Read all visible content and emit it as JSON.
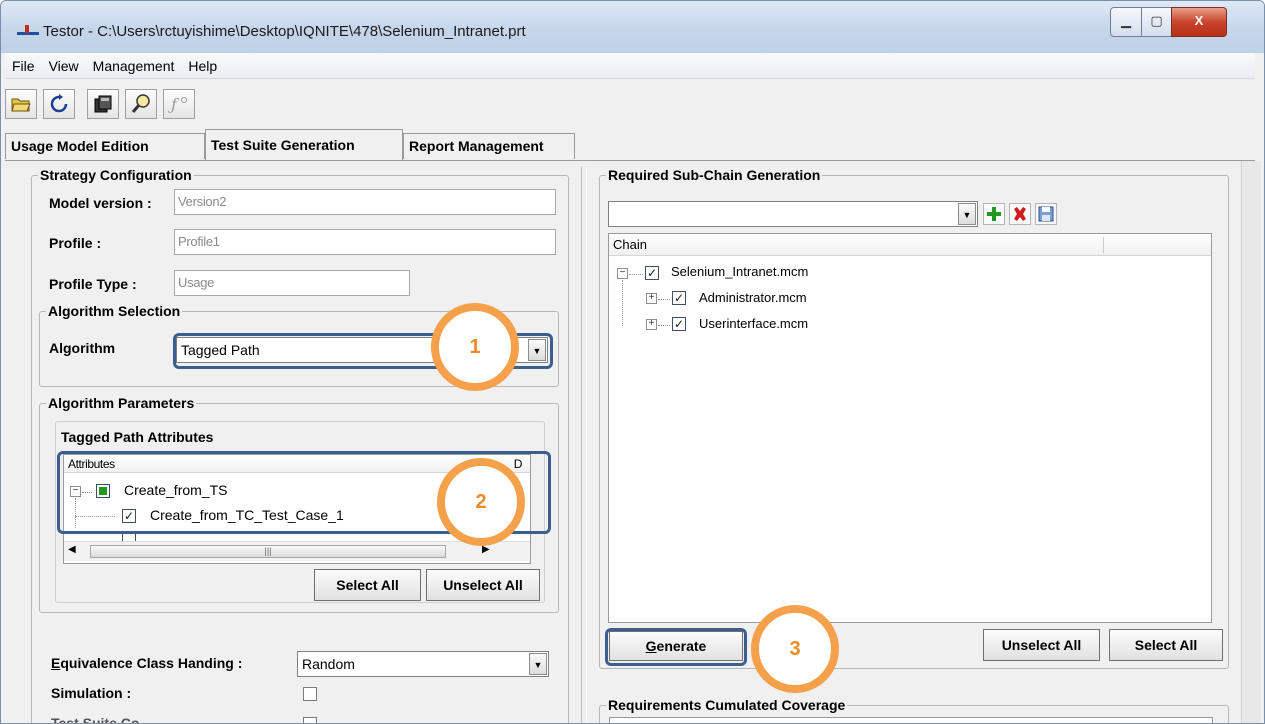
{
  "window": {
    "title": "Testor - C:\\Users\\rctuyishime\\Desktop\\IQNITE\\478\\Selenium_Intranet.prt",
    "controls": {
      "minimize": "▁",
      "maximize": "▢",
      "close": "X"
    }
  },
  "menu": [
    "File",
    "View",
    "Management",
    "Help"
  ],
  "toolbar": [
    "open-icon",
    "refresh-icon",
    "database-icon",
    "magnifier-icon",
    "function-icon"
  ],
  "tabs": [
    {
      "label": "Usage Model Edition",
      "active": false
    },
    {
      "label": "Test Suite Generation",
      "active": true
    },
    {
      "label": "Report Management",
      "active": false
    }
  ],
  "strategy": {
    "legend": "Strategy Configuration",
    "model_version_label": "Model version :",
    "model_version_value": "Version2",
    "profile_label": "Profile :",
    "profile_value": "Profile1",
    "profile_type_label": "Profile Type :",
    "profile_type_value": "Usage"
  },
  "algorithm_selection": {
    "legend": "Algorithm Selection",
    "label": "Algorithm",
    "value": "Tagged Path"
  },
  "algorithm_parameters": {
    "legend": "Algorithm Parameters",
    "subtitle": "Tagged Path Attributes",
    "column_header": "Attributes",
    "column_header_2": "D",
    "items": [
      "Create_from_TS",
      "Create_from_TC_Test_Case_1"
    ],
    "select_all": "Select All",
    "unselect_all": "Unselect All"
  },
  "equivalence": {
    "label": "Equivalence Class Handing :",
    "value": "Random",
    "simulation_label": "Simulation :",
    "cut_label": "Test Suite Co"
  },
  "subchain": {
    "legend": "Required Sub-Chain Generation",
    "column_header": "Chain",
    "tree": [
      "Selenium_Intranet.mcm",
      "Administrator.mcm",
      "Userinterface.mcm"
    ],
    "generate": "Generate",
    "unselect_all": "Unselect All",
    "select_all": "Select All"
  },
  "coverage": {
    "legend": "Requirements Cumulated Coverage"
  },
  "callouts": [
    "1",
    "2",
    "3"
  ],
  "colors": {
    "accent_orange": "#f5a04a",
    "highlight_blue": "#3b5e8c",
    "check_green": "#1f9a1f"
  }
}
